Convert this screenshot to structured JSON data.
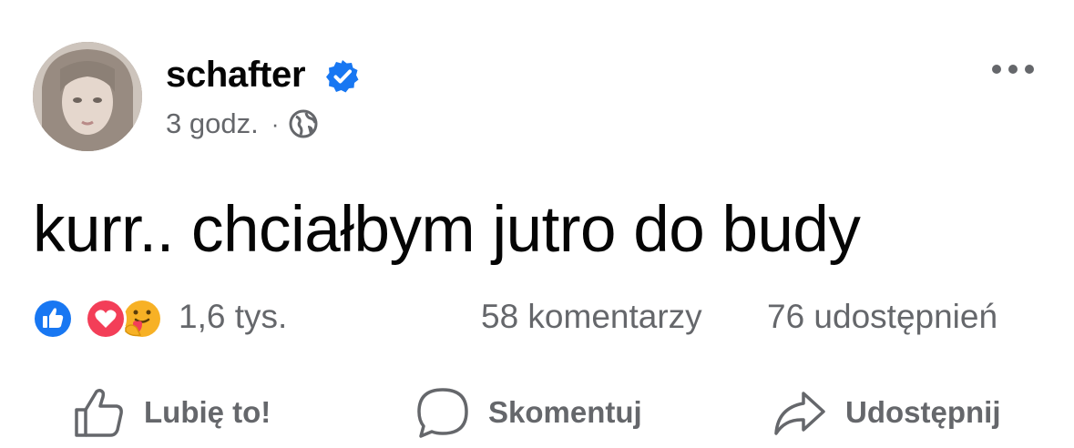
{
  "post": {
    "author": "schafter",
    "time": "3 godz.",
    "separator": "·",
    "text": "kurr.. chciałbym jutro do budy"
  },
  "icons": {
    "verified": "verified-badge-icon",
    "audience": "globe-icon",
    "menu": "more-options-icon",
    "reactions": [
      "like-reaction-icon",
      "love-reaction-icon",
      "care-reaction-icon"
    ]
  },
  "stats": {
    "reactions": "1,6 tys.",
    "comments": "58 komentarzy",
    "shares": "76 udostępnień"
  },
  "actions": {
    "like": "Lubię to!",
    "comment": "Skomentuj",
    "share": "Udostępnij"
  },
  "colors": {
    "accent": "#1877f2",
    "secondary_text": "#65676b",
    "love": "#f33e58",
    "care": "#f7b125"
  }
}
